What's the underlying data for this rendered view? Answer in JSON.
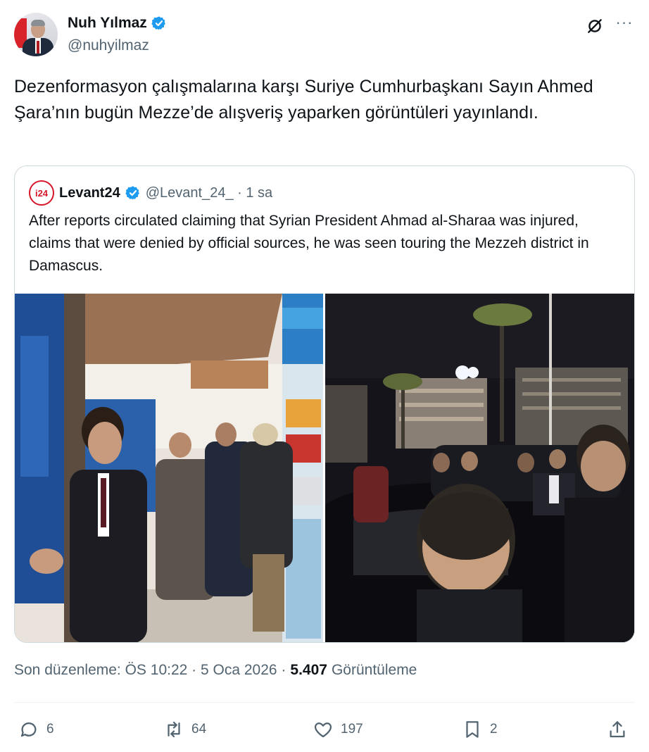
{
  "author": {
    "display_name": "Nuh Yılmaz",
    "handle": "@nuhyilmaz",
    "verified": true
  },
  "tweet": {
    "text": "Dezenformasyon çalışmalarına karşı Suriye Cumhurbaşkanı Sayın Ahmed Şara’nın bugün Mezze’de alışveriş yaparken görüntüleri yayınlandı."
  },
  "quote": {
    "avatar_text": "i24",
    "display_name": "Levant24",
    "handle_time": "@Levant_24_ · 1 sa",
    "text": "After reports circulated claiming that Syrian President Ahmad al-Sharaa was injured, claims that were denied by official sources, he was seen touring the Mezzeh district in Damascus."
  },
  "meta": {
    "edited_label": "Son düzenleme: ÖS 10:22 · 5 Oca 2026 ·",
    "views_count": "5.407",
    "views_label": "Görüntüleme"
  },
  "actions": {
    "replies": "6",
    "reposts": "64",
    "likes": "197",
    "bookmarks": "2"
  },
  "colors": {
    "verified": "#1d9bf0",
    "text": "#0f1419",
    "secondary": "#536471",
    "border": "#cfd9de"
  },
  "icons": [
    "verified-badge-icon",
    "grok-icon",
    "more-icon",
    "reply-icon",
    "repost-icon",
    "like-icon",
    "bookmark-icon",
    "share-icon"
  ]
}
